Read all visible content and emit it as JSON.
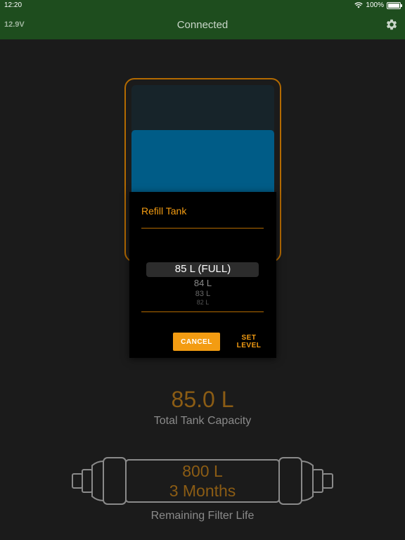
{
  "status_bar": {
    "time": "12:20",
    "battery": "100%"
  },
  "nav": {
    "voltage": "12.9V",
    "title": "Connected"
  },
  "dialog": {
    "title": "Refill Tank",
    "picker": [
      "85 L (FULL)",
      "84 L",
      "83 L",
      "82 L"
    ],
    "cancel_label": "CANCEL",
    "set_label": "SET LEVEL"
  },
  "tank": {
    "level_fraction": 0.74
  },
  "capacity": {
    "value": "85.0 L",
    "label": "Total Tank Capacity"
  },
  "filter": {
    "liters": "800 L",
    "months": "3 Months",
    "label": "Remaining Filter Life"
  },
  "colors": {
    "nav_green": "#1e4d1e",
    "accent_orange": "#f39c12",
    "water_blue": "#005c87",
    "background": "#1b1b1b"
  }
}
